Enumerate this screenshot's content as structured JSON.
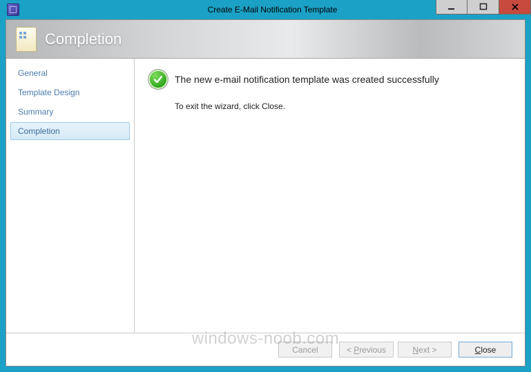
{
  "window": {
    "title": "Create E-Mail Notification Template"
  },
  "banner": {
    "title": "Completion"
  },
  "sidebar": {
    "items": [
      {
        "label": "General",
        "active": false
      },
      {
        "label": "Template Design",
        "active": false
      },
      {
        "label": "Summary",
        "active": false
      },
      {
        "label": "Completion",
        "active": true
      }
    ]
  },
  "content": {
    "success_message": "The new e-mail notification template was created successfully",
    "instruction": "To exit the wizard, click Close."
  },
  "footer": {
    "cancel": "Cancel",
    "previous_prefix": "< ",
    "previous_mn": "P",
    "previous_rest": "revious",
    "next_mn": "N",
    "next_rest": "ext >",
    "close_mn": "C",
    "close_rest": "lose"
  },
  "watermark": "windows-noob.com"
}
